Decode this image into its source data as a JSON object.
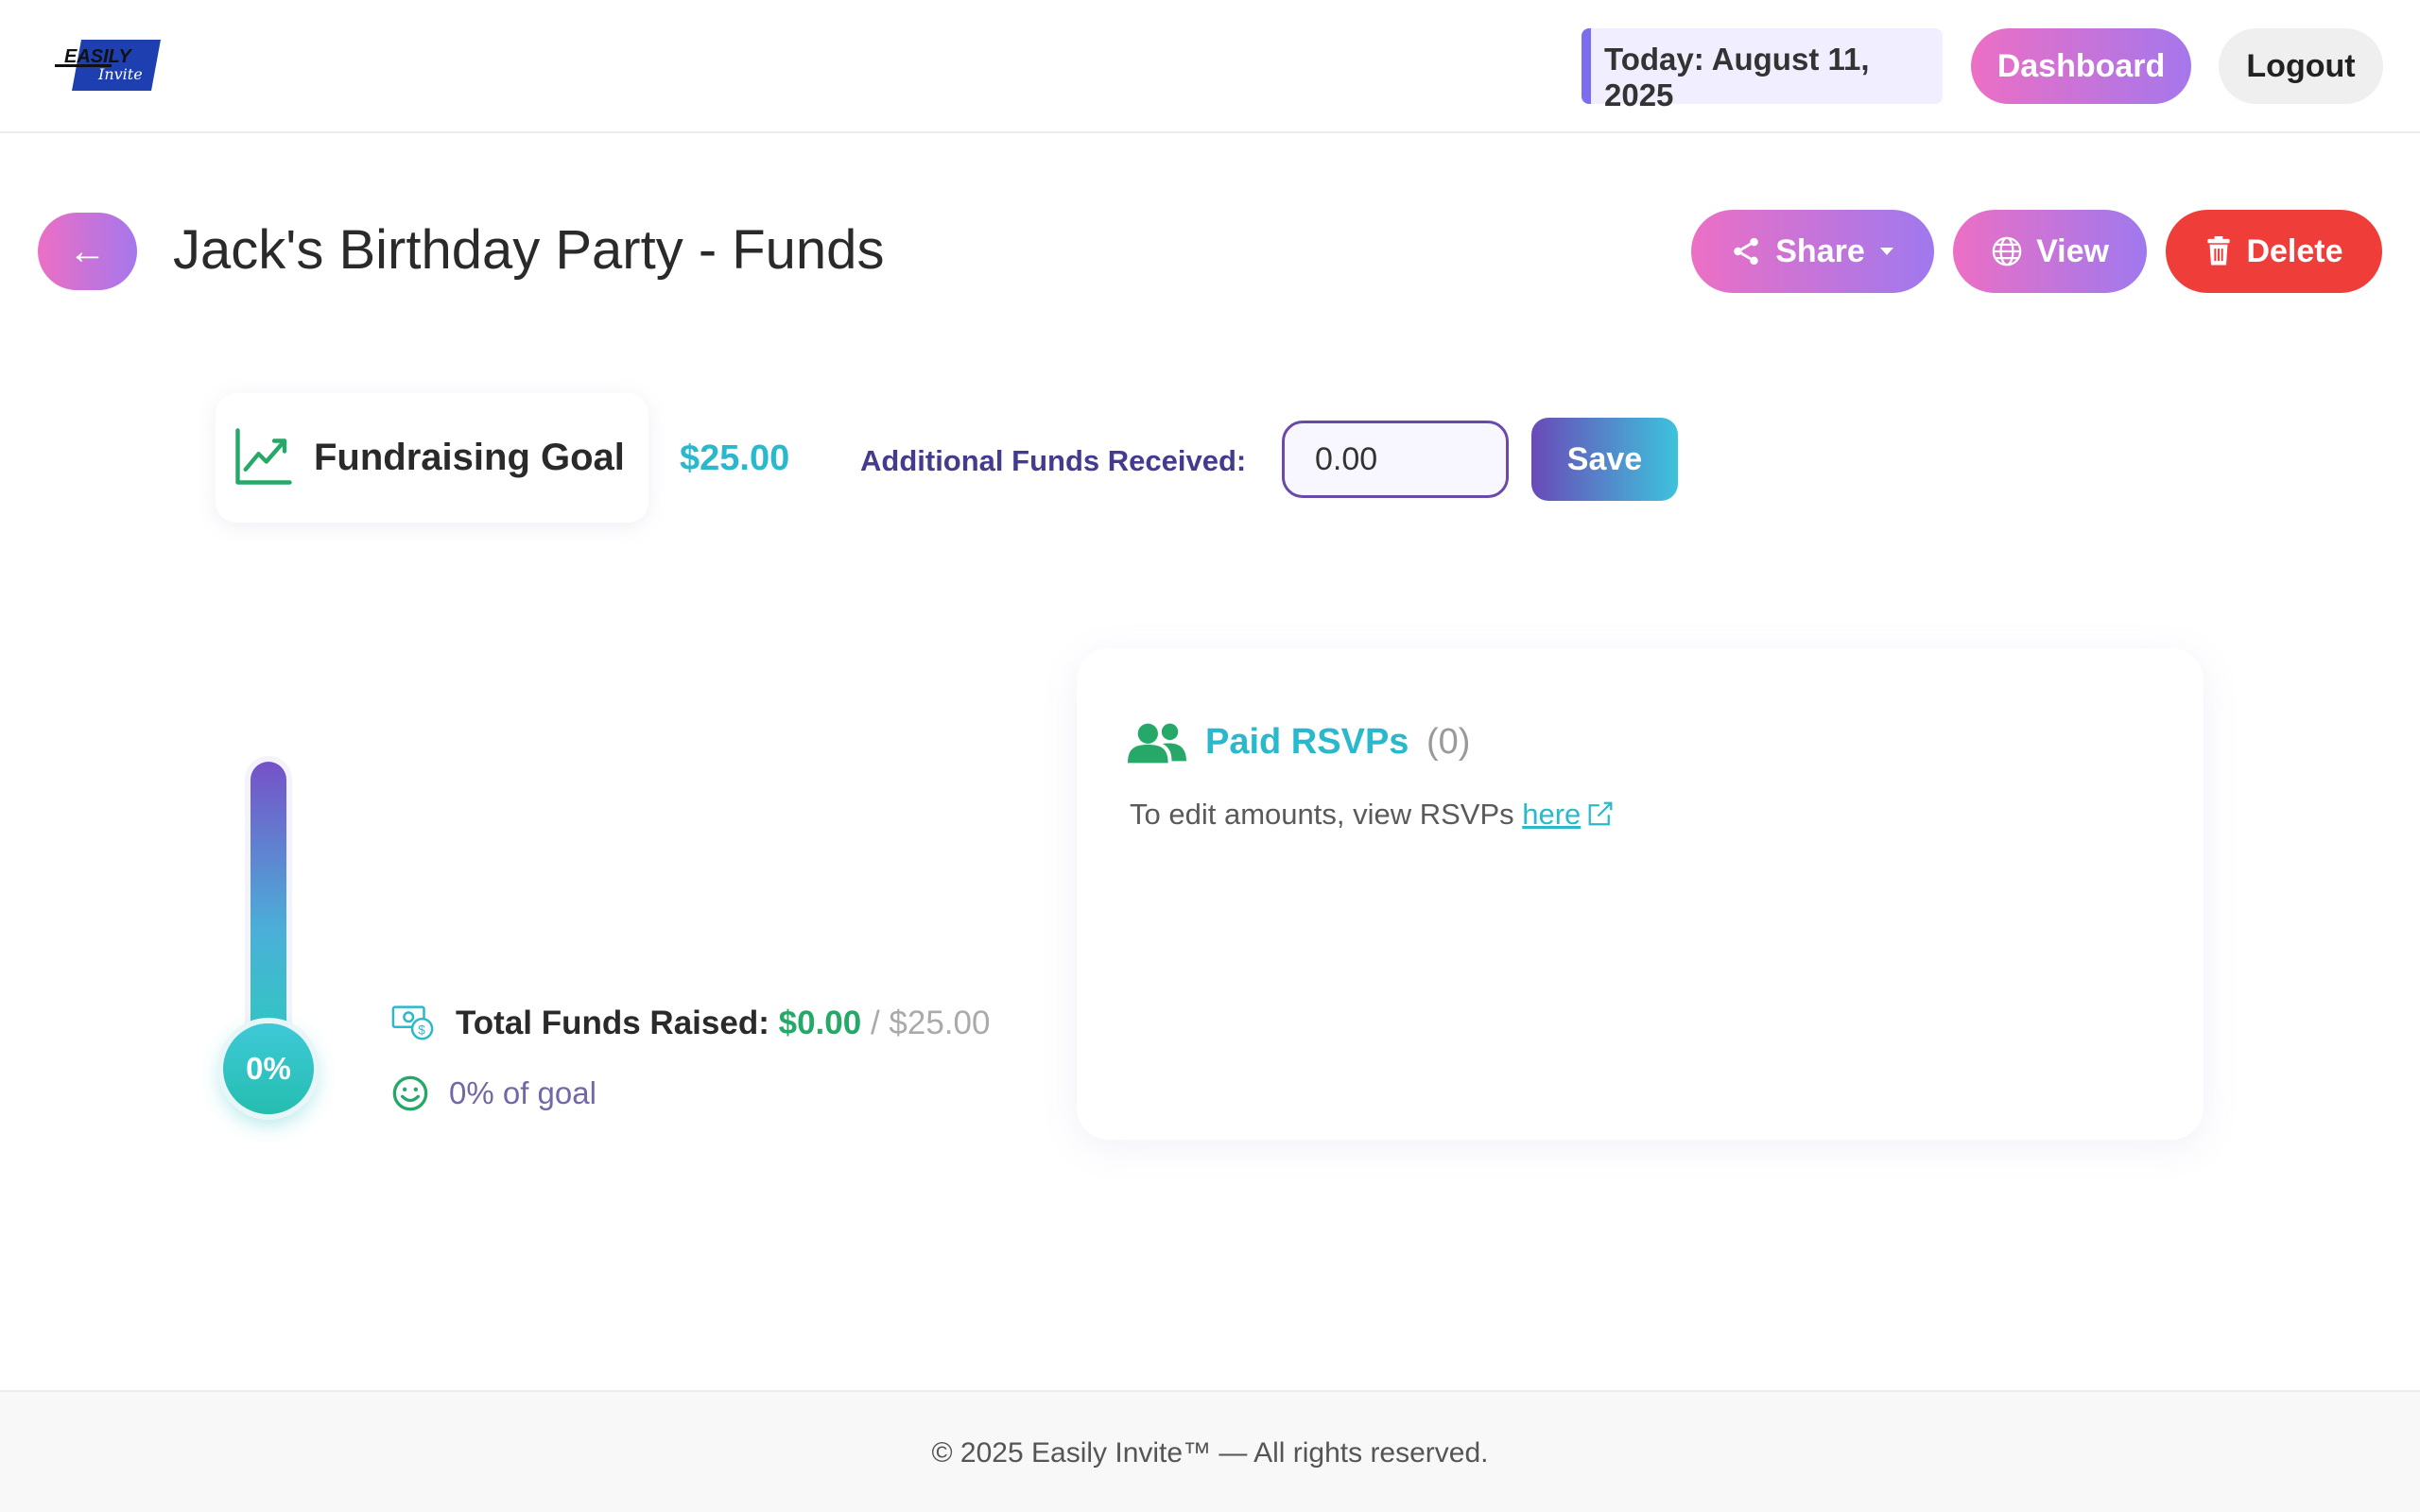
{
  "header": {
    "logo_text_top": "EASILY",
    "logo_text_bottom": "Invite",
    "today": "Today: August 11, 2025",
    "dashboard_label": "Dashboard",
    "logout_label": "Logout"
  },
  "title_row": {
    "back_label": "←",
    "title": "Jack's Birthday Party - Funds",
    "share_label": "Share",
    "view_label": "View",
    "delete_label": "Delete"
  },
  "goal": {
    "label": "Fundraising Goal",
    "amount": "$25.00",
    "additional_label": "Additional Funds Received:",
    "additional_value": "0.00",
    "save_label": "Save"
  },
  "progress": {
    "percent_label": "0%",
    "percent_value": 0,
    "total_label": "Total Funds Raised:",
    "total_value": "$0.00",
    "goal_suffix": "/ $25.00",
    "of_goal": "0% of goal"
  },
  "rsvps": {
    "title": "Paid RSVPs",
    "count": "(0)",
    "note": "To edit amounts, view RSVPs ",
    "link_text": "here"
  },
  "footer": {
    "text": "© 2025 Easily Invite™ — All rights reserved."
  },
  "icons": {
    "share": "share-icon",
    "view": "globe-icon",
    "delete": "trash-icon",
    "goal": "trending-up-icon",
    "money": "money-icon",
    "smile": "smile-icon",
    "rsvp": "users-icon",
    "external": "external-link-icon"
  },
  "colors": {
    "accent_gradient_start": "#ec6fc4",
    "accent_gradient_end": "#a577ec",
    "teal": "#2ab9cc",
    "green": "#26a968",
    "delete_red": "#ef3e3a",
    "indigo": "#433b8f"
  }
}
